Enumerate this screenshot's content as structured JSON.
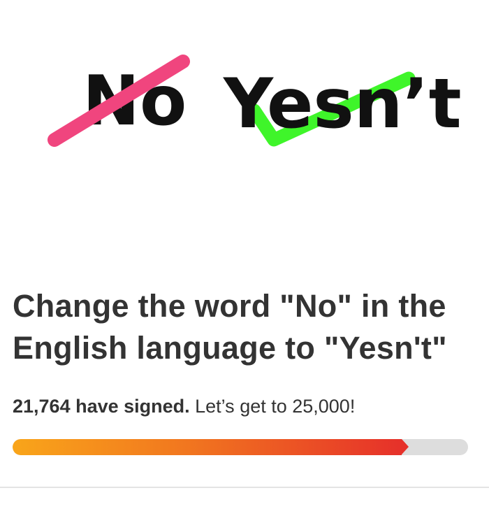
{
  "hero": {
    "crossed_word": "No",
    "replacement_word": "Yesn’t",
    "strike_color": "#f0457e",
    "check_color": "#3ff52a",
    "ink_color": "#111111"
  },
  "petition": {
    "title": "Change the word \"No\" in the English language to \"Yesn't\"",
    "signed_count_text": "21,764 have signed.",
    "goal_text": " Let’s get to 25,000!",
    "signed": 21764,
    "goal": 25000,
    "progress_fraction": 0.87
  },
  "colors": {
    "progress_start": "#f9a51a",
    "progress_end": "#e6312a",
    "progress_track": "#dddddd",
    "text": "#333333"
  }
}
